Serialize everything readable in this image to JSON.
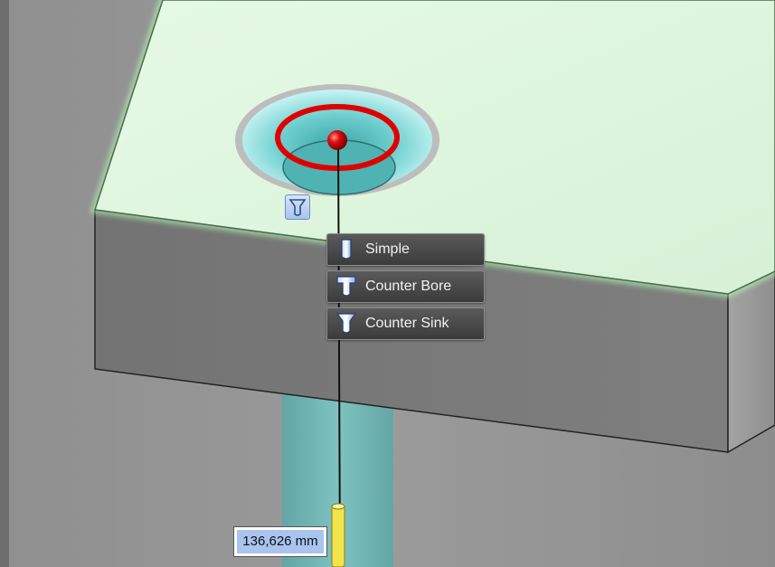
{
  "scene": {
    "colors": {
      "top_face": "#e0f5e0",
      "front_face": "#7a7a7a",
      "side_face": "#9c9c9c",
      "background": "#959595",
      "hole_outline": "#e00000",
      "hole_fill": "#9be3e3",
      "preview_shaft": "#6bbdbd",
      "handle": "#f2e44a"
    }
  },
  "hole_type_menu": {
    "active_icon": "countersink-icon",
    "options": [
      {
        "label": "Simple",
        "icon": "simple-hole-icon"
      },
      {
        "label": "Counter Bore",
        "icon": "counterbore-icon"
      },
      {
        "label": "Counter Sink",
        "icon": "countersink-icon"
      }
    ]
  },
  "depth_dimension": {
    "value": "136,626 mm"
  }
}
